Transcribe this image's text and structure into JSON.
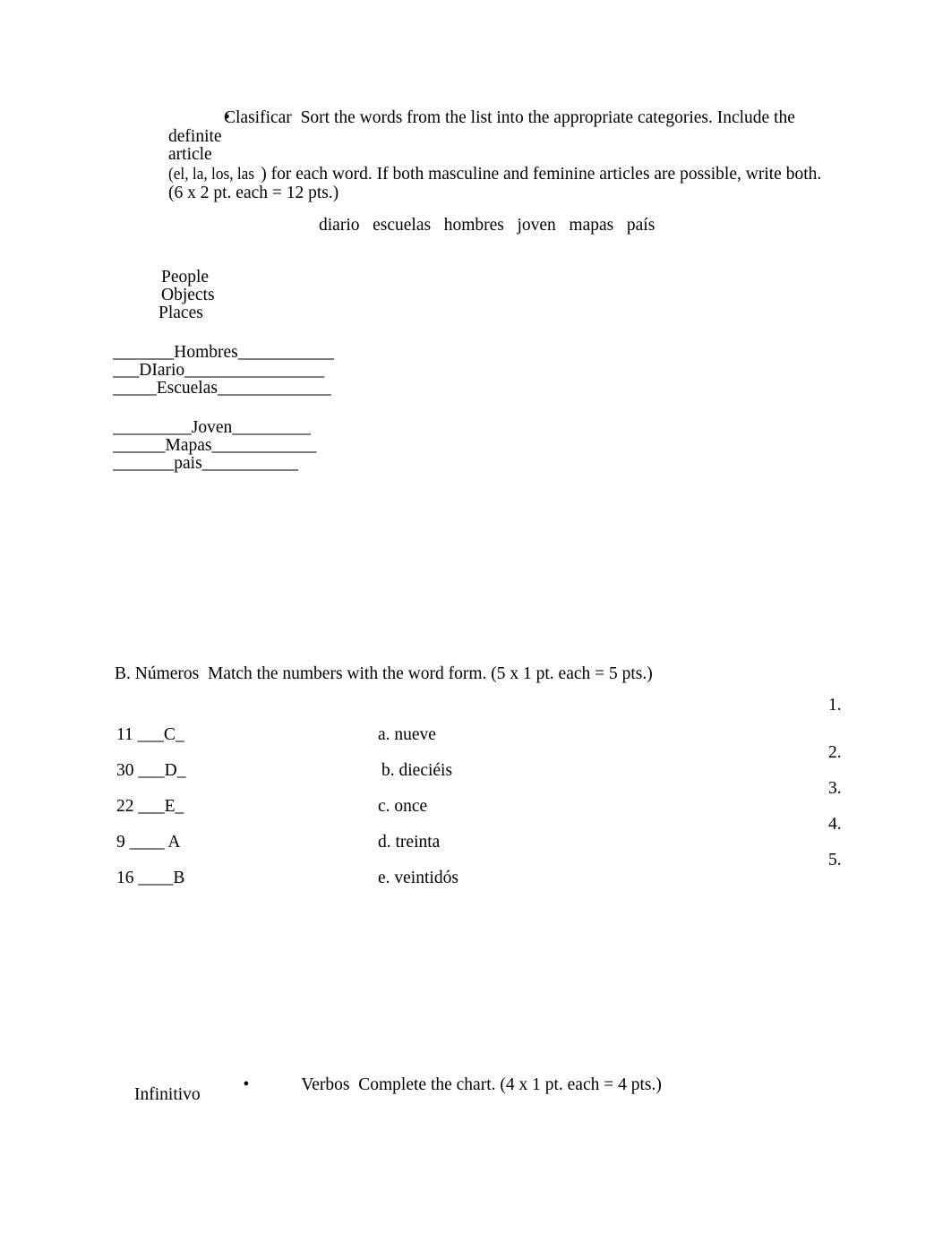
{
  "document": {
    "sections": {
      "a": {
        "bullet_glyph": "•",
        "title": "Clasificar",
        "instruction_line1": "Sort the words from the list into the appropriate categories. Include the definite",
        "instruction_line1_wrap": "article",
        "instruction_line2_paren": "(el, la, los, las",
        "instruction_line2_rest": ") for each word. If both masculine and feminine articles are possible, write both.",
        "points_line": "(6 x 2 pt. each = 12 pts.)",
        "word_list": "diario   escuelas   hombres   joven   mapas   país",
        "words": [
          "diario",
          "escuelas",
          "hombres",
          "joven",
          "mapas",
          "país"
        ],
        "categories": [
          "People",
          "Objects",
          "Places"
        ],
        "answer_lines": [
          "_______Hombres___________",
          "___DIario________________",
          "_____Escuelas_____________",
          "_________Joven_________",
          "______Mapas____________",
          "_______pais___________"
        ]
      },
      "b": {
        "heading": "B. Números  Match the numbers with the word form. (5 x 1 pt. each = 5 pts.)",
        "number_items": [
          "11 ___C_",
          "30 ___D_",
          "22 ___E_",
          "9 ____ A",
          "16 ____B"
        ],
        "answer_choices": [
          "a. nueve",
          "b. dieciéis",
          "c. once",
          "d. treinta",
          "e. veintidós"
        ],
        "right_numbers": [
          "1.",
          "2.",
          "3.",
          "4.",
          "5."
        ]
      },
      "c": {
        "bullet_glyph": "•",
        "title": "Verbos",
        "instruction": "Complete the chart. (4 x 1 pt. each = 4 pts.)",
        "table_header": "Infinitivo"
      }
    }
  }
}
